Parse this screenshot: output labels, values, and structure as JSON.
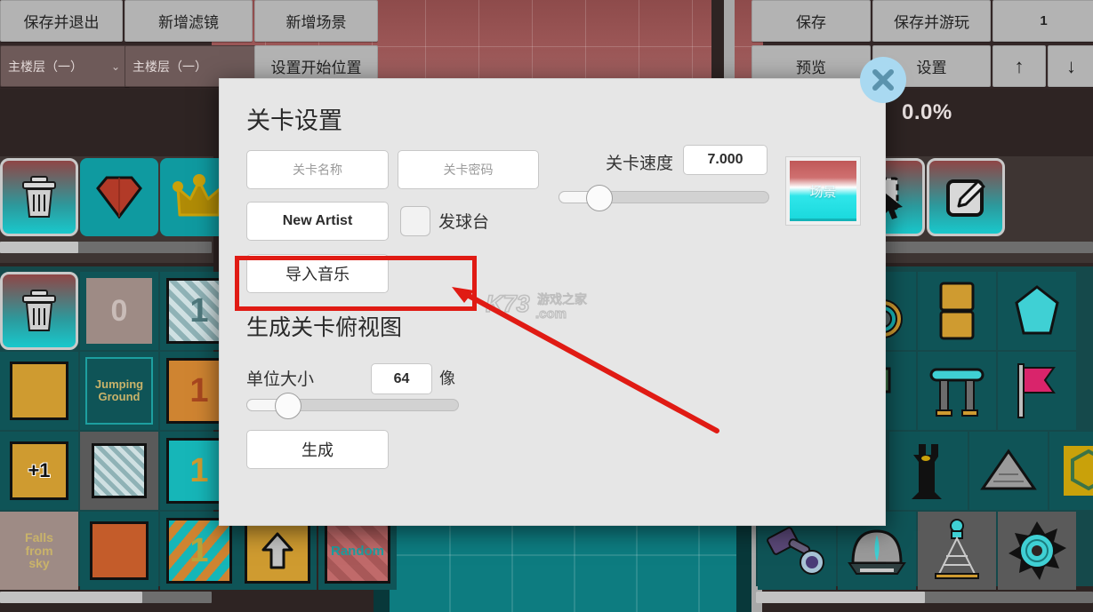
{
  "toolbar": {
    "save_and_exit": "保存并退出",
    "add_filter": "新增滤镜",
    "add_scene": "新增场景",
    "floor_select": "主楼层（一）",
    "floor_label": "主楼层（一）",
    "set_start_position": "设置开始位置",
    "save": "保存",
    "save_and_play": "保存并游玩",
    "page_number": "1",
    "preview": "预览",
    "settings": "设置",
    "up_arrow": "↑",
    "down_arrow": "↓",
    "progress_percent": "0.0%"
  },
  "dialog": {
    "title": "关卡设置",
    "level_name_placeholder": "关卡名称",
    "level_name_value": "",
    "level_password_placeholder": "关卡密码",
    "level_password_value": "",
    "speed_label": "关卡速度",
    "speed_value": "7.000",
    "speed_slider_percent": 19,
    "artist_button": "New Artist",
    "tee_checkbox_label": "发球台",
    "tee_checkbox_checked": false,
    "import_music_button": "导入音乐",
    "scene_thumb_label": "场景",
    "section_title": "生成关卡俯视图",
    "unit_size_label": "单位大小",
    "unit_size_value": "64",
    "unit_size_suffix": "像",
    "unit_size_slider_percent": 19,
    "generate_button": "生成"
  },
  "close_button": {
    "name": "关闭",
    "circle_color": "#a9d9f1",
    "glyph_color": "#5b93ad"
  },
  "annotation": {
    "highlight_color": "#e01b14",
    "arrow_color": "#e01b14"
  },
  "watermark": {
    "brand": "K73",
    "cn": "游戏之家",
    "tld": ".com"
  },
  "palette": {
    "left_top_row": [
      {
        "name": "delete-tile",
        "icon": "trash-icon",
        "label": ""
      },
      {
        "name": "gem-tile",
        "icon": "gem-icon",
        "label": ""
      },
      {
        "name": "crown-tile",
        "icon": "crown-icon",
        "label": ""
      }
    ],
    "left_grid": [
      [
        {
          "name": "delete-tile",
          "icon": "trash-icon",
          "label": ""
        },
        {
          "name": "block-zero-tile",
          "icon": "block-0",
          "label": "0"
        },
        {
          "name": "block-one-hatched-tile",
          "icon": "block-1-hatched",
          "label": "1"
        }
      ],
      [
        {
          "name": "gold-block-tile",
          "icon": "gold-block",
          "label": ""
        },
        {
          "name": "jumping-ground-tile",
          "icon": "text-tile",
          "label": "Jumping\nGround"
        },
        {
          "name": "orange-one-tile",
          "icon": "block-1-orange",
          "label": "1"
        }
      ],
      [
        {
          "name": "plus-one-tile",
          "icon": "plus-one-block",
          "label": "+1"
        },
        {
          "name": "hatched-block-tile",
          "icon": "hatched-block",
          "label": ""
        },
        {
          "name": "teal-one-tile",
          "icon": "block-1-teal",
          "label": "1"
        }
      ],
      [
        {
          "name": "falls-from-sky-tile",
          "icon": "text-tile",
          "label": "Falls\nfrom\nsky"
        },
        {
          "name": "orange-block-tile",
          "icon": "orange-block",
          "label": ""
        },
        {
          "name": "striped-one-tile",
          "icon": "block-1-striped",
          "label": "1"
        }
      ]
    ],
    "left_bottom_row": [
      {
        "name": "gold-arrow-tile",
        "icon": "up-arrow-block",
        "label": ""
      },
      {
        "name": "random-tile",
        "icon": "random-block",
        "label": "Random"
      }
    ],
    "right_top_row": [
      {
        "name": "tool-circle-tile",
        "icon": "circle-tool-icon",
        "label": ""
      },
      {
        "name": "select-tool-tile",
        "icon": "marquee-select-icon",
        "label": ""
      },
      {
        "name": "edit-tool-tile",
        "icon": "pencil-edit-icon",
        "label": ""
      }
    ],
    "right_grid": [
      [
        {
          "name": "cannon-tile",
          "icon": "cannon-icon",
          "label": ""
        },
        {
          "name": "saw-blade-tile",
          "icon": "spinning-blade-icon",
          "label": ""
        },
        {
          "name": "gold-pillar-tile",
          "icon": "gold-pillar-icon",
          "label": ""
        },
        {
          "name": "crystal-tile",
          "icon": "crystal-icon",
          "label": ""
        }
      ],
      [
        {
          "name": "sphere-tile",
          "icon": "sphere-icon",
          "label": ""
        },
        {
          "name": "tree-tile",
          "icon": "tree-icon",
          "label": ""
        },
        {
          "name": "table-tile",
          "icon": "table-icon",
          "label": ""
        },
        {
          "name": "flag-tile",
          "icon": "flag-icon",
          "label": ""
        }
      ],
      [
        {
          "name": "rook-tower-tile",
          "icon": "rook-tower-icon",
          "label": ""
        },
        {
          "name": "pyramid-tile",
          "icon": "pyramid-icon",
          "label": ""
        },
        {
          "name": "gold-gear-tile",
          "icon": "gold-gear-icon",
          "label": ""
        }
      ],
      [
        {
          "name": "hammer-tile",
          "icon": "hammer-icon",
          "label": ""
        },
        {
          "name": "dome-tile",
          "icon": "dome-icon",
          "label": ""
        },
        {
          "name": "tower-frame-tile",
          "icon": "tower-frame-icon",
          "label": ""
        },
        {
          "name": "spiky-saw-tile",
          "icon": "spiky-saw-icon",
          "label": ""
        }
      ]
    ]
  }
}
